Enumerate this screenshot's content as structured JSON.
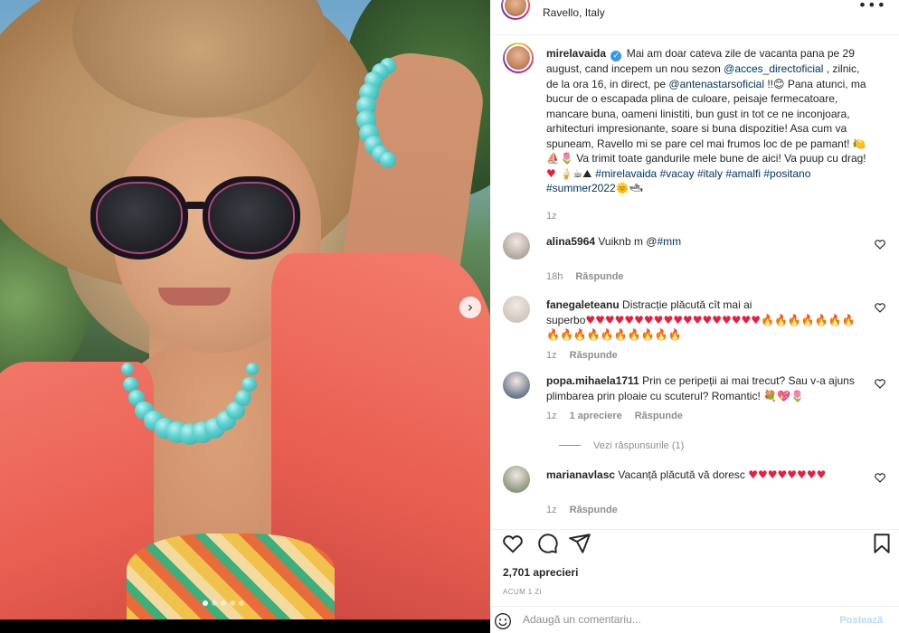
{
  "post": {
    "location": "Ravello, Italy",
    "more_label": "•••",
    "image_next": "›",
    "carousel_dots": 5,
    "carousel_active": 0
  },
  "caption": {
    "username": "mirelavaida",
    "verified_mark": "✓",
    "segments": [
      {
        "t": "Mai am doar cateva zile de vacanta pana pe 29 august, cand incepem un nou sezon ",
        "k": "text"
      },
      {
        "t": "@acces_directoficial",
        "k": "link"
      },
      {
        "t": " , zilnic, de la ora 16, in direct, pe ",
        "k": "text"
      },
      {
        "t": "@antenastarsoficial",
        "k": "link"
      },
      {
        "t": " !!",
        "k": "text"
      },
      {
        "t": "😊",
        "k": "emo"
      },
      {
        "t": "  Pana atunci, ma bucur de o escapada plina de culoare, peisaje fermecatoare, mancare buna, oameni linistiti, bun gust in tot ce ne inconjoara, arhitecturi impresionante, soare si buna dispozitie! Asa cum va spuneam, Ravello mi se pare cel mai frumos loc de pe pamant! ",
        "k": "text"
      },
      {
        "t": "🍋⛵🌷",
        "k": "emo"
      },
      {
        "t": "  Va trimit toate gandurile mele bune de aici! Va puup cu drag! ",
        "k": "text"
      },
      {
        "t": "♥",
        "k": "heart"
      },
      {
        "t": " 🍦☕⛰ ",
        "k": "emo"
      },
      {
        "t": "#mirelavaida",
        "k": "link"
      },
      {
        "t": " ",
        "k": "text"
      },
      {
        "t": "#vacay",
        "k": "link"
      },
      {
        "t": " ",
        "k": "text"
      },
      {
        "t": "#italy",
        "k": "link"
      },
      {
        "t": " ",
        "k": "text"
      },
      {
        "t": "#amalfi",
        "k": "link"
      },
      {
        "t": " ",
        "k": "text"
      },
      {
        "t": "#positano",
        "k": "link"
      },
      {
        "t": " ",
        "k": "text"
      },
      {
        "t": "#summer2022",
        "k": "link"
      },
      {
        "t": "🌞🛥",
        "k": "emo"
      }
    ],
    "time": "1z"
  },
  "comments": [
    {
      "username": "alina5964",
      "segments": [
        {
          "t": "Vuiknb m @",
          "k": "text"
        },
        {
          "t": "#mm",
          "k": "link"
        }
      ],
      "time": "18h",
      "likes": "",
      "reply_label": "Răspunde",
      "avatar_color": "#b3a6a0"
    },
    {
      "username": "fanegaleteanu",
      "segments": [
        {
          "t": "Distracție plăcută cît mai ai superbo",
          "k": "text"
        },
        {
          "t": "♥♥♥♥♥♥♥♥♥♥♥♥♥♥♥♥♥♥",
          "k": "heart"
        },
        {
          "t": "🔥🔥🔥🔥🔥🔥🔥🔥🔥🔥🔥🔥🔥🔥🔥🔥🔥",
          "k": "fire"
        }
      ],
      "time": "1z",
      "likes": "",
      "reply_label": "Răspunde",
      "avatar_color": "#cfc7bf"
    },
    {
      "username": "popa.mihaela1711",
      "segments": [
        {
          "t": "Prin ce peripeții ai mai trecut? Sau v-a ajuns plimbarea prin ploaie cu scuterul? Romantic! ",
          "k": "text"
        },
        {
          "t": "💐💖🌷",
          "k": "emo"
        }
      ],
      "time": "1z",
      "likes": "1 apreciere",
      "reply_label": "Răspunde",
      "avatar_color": "#6d7a8c",
      "view_replies": "Vezi răspunsurile (1)"
    },
    {
      "username": "marianavlasc",
      "segments": [
        {
          "t": "Vacanță plăcută vă doresc ",
          "k": "text"
        },
        {
          "t": "♥♥♥♥♥♥♥♥",
          "k": "heart"
        }
      ],
      "time": "1z",
      "likes": "",
      "reply_label": "Răspunde",
      "avatar_color": "#8d9a7d"
    }
  ],
  "stats": {
    "likes": "2,701 aprecieri",
    "when": "ACUM 1 ZI"
  },
  "add_comment": {
    "placeholder": "Adaugă un comentariu...",
    "post_label": "Postează"
  },
  "colors": {
    "link": "#00376b",
    "muted": "#8e8e8e",
    "heart": "#ed1c3a",
    "post_button_disabled": "#b2dffc"
  }
}
